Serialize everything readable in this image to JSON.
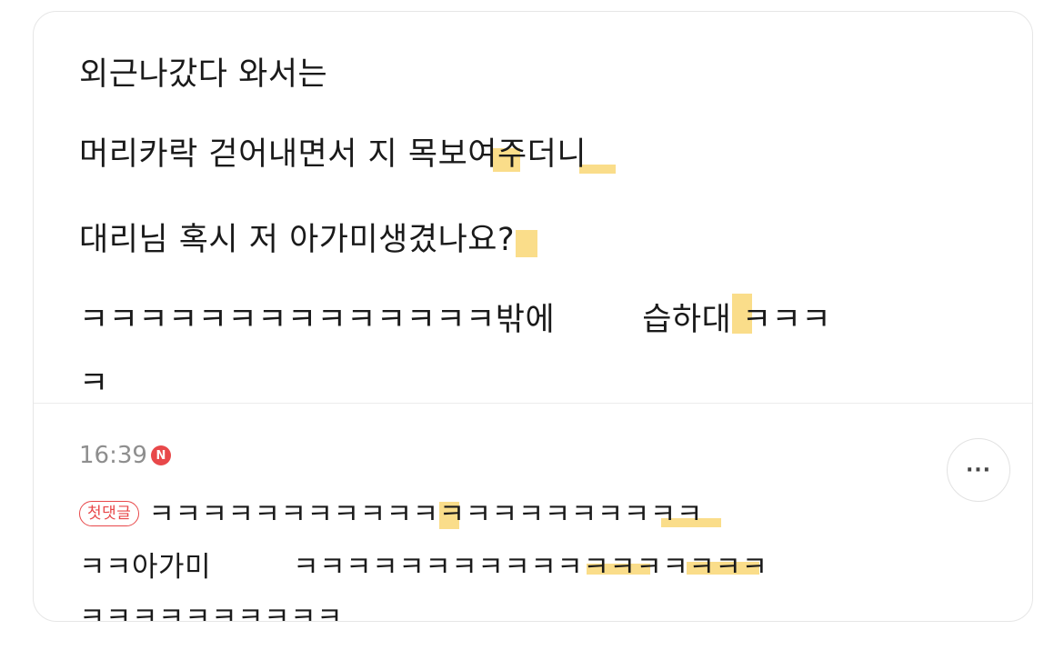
{
  "post": {
    "lines": [
      "외근나갔다 와서는",
      "머리카락 걷어내면서 지 목보여주더니",
      "대리님 혹시 저 아가미생겼나요?",
      "ㅋㅋㅋㅋㅋㅋㅋㅋㅋㅋㅋㅋㅋㅋ밖에",
      "습하대 ㅋㅋㅋ",
      "ㅋ"
    ]
  },
  "comment": {
    "time": "16:39",
    "new_badge": "N",
    "first_badge": "첫댓글",
    "more_label": "···",
    "lines": [
      "ㅋㅋㅋㅋㅋㅋㅋㅋㅋㅋㅋㅋㅋㅋㅋㅋㅋㅋㅋㅋㅋ",
      "ㅋㅋ아가미",
      "ㅋㅋㅋㅋㅋㅋㅋㅋㅋㅋㅋㅋㅋㅋㅋㅋㅋㅋ",
      "ㅋㅋㅋㅋㅋㅋㅋㅋㅋㅋ"
    ]
  },
  "colors": {
    "accent_red": "#e8484a",
    "highlight": "#f6c12a"
  }
}
